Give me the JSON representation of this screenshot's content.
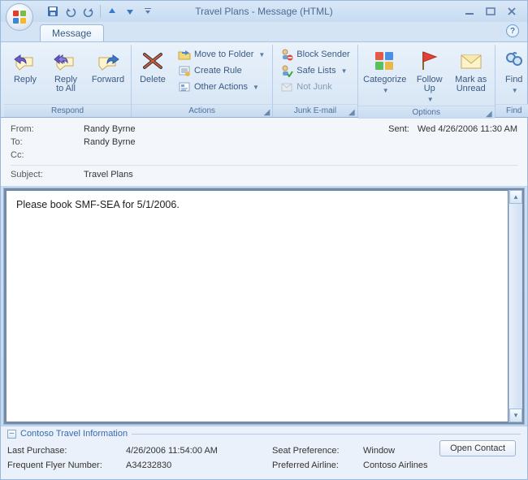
{
  "window": {
    "title": "Travel Plans - Message (HTML)"
  },
  "qat": {
    "save": "save",
    "undo": "undo",
    "redo": "redo",
    "prev": "prev",
    "next": "next"
  },
  "tabs": {
    "message": "Message"
  },
  "ribbon": {
    "respond": {
      "label": "Respond",
      "reply": "Reply",
      "reply_all": "Reply\nto All",
      "forward": "Forward"
    },
    "actions": {
      "label": "Actions",
      "delete": "Delete",
      "move_to_folder": "Move to Folder",
      "create_rule": "Create Rule",
      "other_actions": "Other Actions"
    },
    "junk": {
      "label": "Junk E-mail",
      "block_sender": "Block Sender",
      "safe_lists": "Safe Lists",
      "not_junk": "Not Junk"
    },
    "options": {
      "label": "Options",
      "categorize": "Categorize",
      "follow_up": "Follow\nUp",
      "mark_unread": "Mark as\nUnread"
    },
    "find": {
      "label": "Find",
      "find": "Find"
    }
  },
  "header": {
    "from_lbl": "From:",
    "from": "Randy Byrne",
    "to_lbl": "To:",
    "to": "Randy Byrne",
    "cc_lbl": "Cc:",
    "cc": "",
    "subject_lbl": "Subject:",
    "subject": "Travel Plans",
    "sent_lbl": "Sent:",
    "sent": "Wed 4/26/2006 11:30 AM"
  },
  "body": {
    "text": "Please book SMF-SEA for 5/1/2006."
  },
  "panel": {
    "title": "Contoso Travel Information",
    "last_purchase_lbl": "Last Purchase:",
    "last_purchase": "4/26/2006 11:54:00 AM",
    "seat_pref_lbl": "Seat Preference:",
    "seat_pref": "Window",
    "ffn_lbl": "Frequent Flyer Number:",
    "ffn": "A34232830",
    "airline_lbl": "Preferred Airline:",
    "airline": "Contoso Airlines",
    "open_contact": "Open Contact"
  }
}
